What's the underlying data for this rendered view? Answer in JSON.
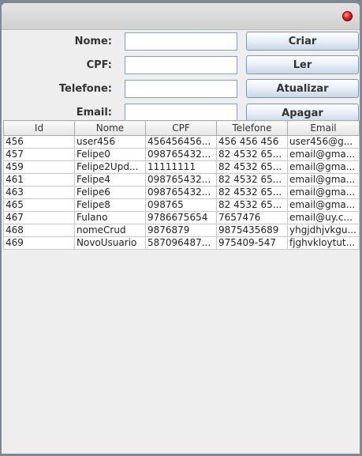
{
  "form": {
    "nome_label": "Nome:",
    "cpf_label": "CPF:",
    "telefone_label": "Telefone:",
    "email_label": "Email:",
    "nome_value": "",
    "cpf_value": "",
    "telefone_value": "",
    "email_value": ""
  },
  "buttons": {
    "criar": "Criar",
    "ler": "Ler",
    "atualizar": "Atualizar",
    "apagar": "Apagar"
  },
  "table": {
    "headers": [
      "Id",
      "Nome",
      "CPF",
      "Telefone",
      "Email"
    ],
    "rows": [
      [
        "456",
        "user456",
        "456456456...",
        "456 456 456",
        "user456@g..."
      ],
      [
        "457",
        "Felipe0",
        "098765432...",
        "82 4532 65...",
        "email@gma..."
      ],
      [
        "459",
        "Felipe2Upd...",
        "11111111",
        "82 4532 65...",
        "email@gma..."
      ],
      [
        "461",
        "Felipe4",
        "098765432...",
        "82 4532 65...",
        "email@gma..."
      ],
      [
        "463",
        "Felipe6",
        "098765432...",
        "82 4532 65...",
        "email@gma..."
      ],
      [
        "465",
        "Felipe8",
        "098765",
        "82 4532 65...",
        "email@gma..."
      ],
      [
        "467",
        "Fulano",
        "9786675654",
        "7657476",
        "email@uy.c..."
      ],
      [
        "468",
        "nomeCrud",
        "9876879",
        "9875435689",
        "yhgjdhjvkgu..."
      ],
      [
        "469",
        "NovoUsuario",
        "587096487...",
        "975409-547",
        "fjghvkloytut..."
      ]
    ]
  }
}
